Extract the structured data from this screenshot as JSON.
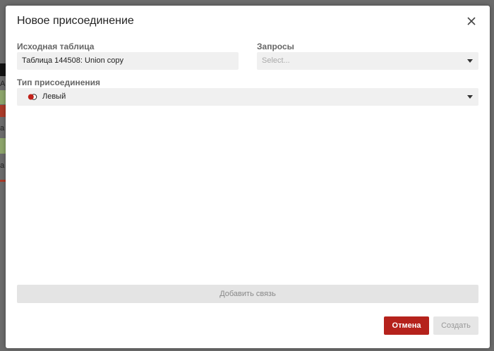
{
  "background": {
    "fragments": [
      "А",
      "а",
      "а",
      "а"
    ]
  },
  "dialog": {
    "title": "Новое присоединение",
    "close_icon": "close-icon",
    "source_table": {
      "label": "Исходная таблица",
      "value": "Таблица 144508: Union copy"
    },
    "queries": {
      "label": "Запросы",
      "placeholder": "Select..."
    },
    "join_type": {
      "label": "Тип присоединения",
      "value": "Левый",
      "icon": "left-join-icon"
    },
    "add_link_label": "Добавить связь",
    "cancel_label": "Отмена",
    "create_label": "Создать"
  },
  "colors": {
    "accent": "#b5221c",
    "field_bg": "#f0f0f0",
    "overlay": "#6b6b6b"
  }
}
